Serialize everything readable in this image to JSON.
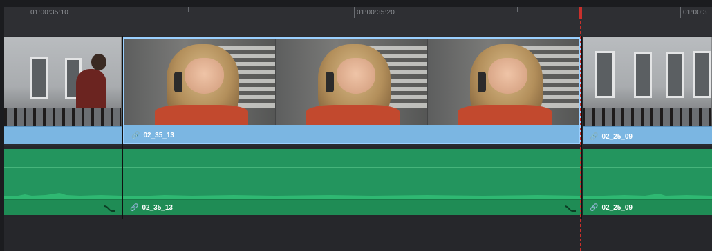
{
  "ruler": {
    "timecodes": [
      "01:00:35:10",
      "01:00:35:20",
      "01:00:3"
    ]
  },
  "video_track": {
    "clips": [
      {
        "name": ""
      },
      {
        "name": "02_35_13"
      },
      {
        "name": "02_25_09"
      }
    ]
  },
  "audio_track": {
    "clips": [
      {
        "name": ""
      },
      {
        "name": "02_35_13"
      },
      {
        "name": "02_25_09"
      }
    ]
  },
  "icons": {
    "link": "🔗",
    "fade_handle": "fade-handle-icon"
  },
  "colors": {
    "video_clip_bar": "#7bb6e2",
    "audio_clip": "#23955e",
    "playhead": "#c9302c",
    "selected_outline": "#9bd0ff"
  }
}
